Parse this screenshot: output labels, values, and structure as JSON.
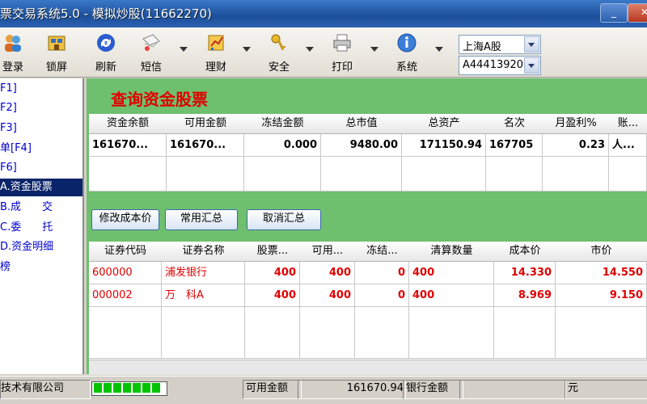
{
  "window": {
    "title": "票交易系统5.0 - 模拟炒股(11662270)",
    "minimize": "_",
    "close": "✕"
  },
  "toolbar": {
    "items": [
      {
        "label": "登录",
        "icon": "login-icon"
      },
      {
        "label": "锁屏",
        "icon": "lock-screen-icon"
      },
      {
        "label": "刷新",
        "icon": "refresh-icon"
      },
      {
        "label": "短信",
        "icon": "message-icon"
      },
      {
        "label": "理财",
        "icon": "finance-icon"
      },
      {
        "label": "安全",
        "icon": "key-icon"
      },
      {
        "label": "打印",
        "icon": "printer-icon"
      },
      {
        "label": "系统",
        "icon": "info-icon"
      }
    ],
    "market_select": "上海A股",
    "account_select": "A44413920"
  },
  "leftnav": {
    "items": [
      {
        "label": "F1]"
      },
      {
        "label": "F2]"
      },
      {
        "label": "F3]"
      },
      {
        "label": "单[F4]"
      },
      {
        "label": "F6]"
      },
      {
        "label": "A.资金股票",
        "selected": true
      },
      {
        "label": "B.成　　交"
      },
      {
        "label": "C.委　　托"
      },
      {
        "label": "D.资金明细"
      },
      {
        "label": "榜"
      }
    ]
  },
  "main": {
    "title": "查询资金股票",
    "fund_table": {
      "headers": [
        "资金余额",
        "可用金额",
        "冻结金额",
        "总市值",
        "总资产",
        "名次",
        "月盈利%",
        "账..."
      ],
      "row": [
        "161670...",
        "161670...",
        "0.000",
        "9480.00",
        "171150.94",
        "167705",
        "0.23",
        "人..."
      ]
    },
    "buttons": {
      "modify_cost": "修改成本价",
      "common_summary": "常用汇总",
      "cancel_summary": "取消汇总"
    },
    "stock_table": {
      "headers": [
        "证券代码",
        "证券名称",
        "股票...",
        "可用...",
        "冻结...",
        "清算数量",
        "成本价",
        "市价"
      ],
      "rows": [
        [
          "600000",
          "浦发银行",
          "400",
          "400",
          "0",
          "400",
          "14.330",
          "14.550"
        ],
        [
          "000002",
          "万　科A",
          "400",
          "400",
          "0",
          "400",
          "8.969",
          "9.150"
        ]
      ]
    }
  },
  "statusbar": {
    "company": "技术有限公司",
    "progress_blocks": 7,
    "available_label": "可用金额",
    "available_value": "161670.94",
    "bank_label": "银行金额",
    "unit": "元"
  },
  "colors": {
    "accent_red": "#e00000",
    "panel_green": "#6ec06e",
    "nav_blue": "#0000cc"
  }
}
